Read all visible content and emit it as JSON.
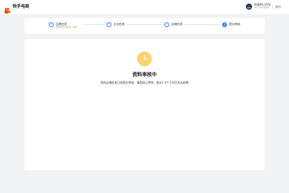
{
  "header": {
    "logo_icon": "kuaishou-logo-icon",
    "brand_color": "#ff4906",
    "app_name": "快手电商",
    "account_name": "阿选的小百号",
    "account_id": "ID: 20918432",
    "logout_label": "退出"
  },
  "steps": [
    {
      "label": "品牌信息",
      "sub": "品牌资料已提交",
      "sub_action": "修改",
      "state": "done",
      "icon": "check-icon"
    },
    {
      "label": "企业信息",
      "state": "done",
      "icon": "check-icon"
    },
    {
      "label": "店铺信息",
      "state": "done",
      "icon": "check-icon"
    },
    {
      "label": "提交审核",
      "number": "4",
      "state": "current"
    }
  ],
  "review": {
    "icon": "clock-icon",
    "icon_color": "#fdd26b",
    "title": "资料审核中",
    "description": "您的店铺信息已经提交审核，请您耐心等待，预计1-3个工作日内出结果"
  },
  "colors": {
    "accent": "#3e7bfa",
    "background": "#f2f3f5",
    "card": "#ffffff"
  }
}
